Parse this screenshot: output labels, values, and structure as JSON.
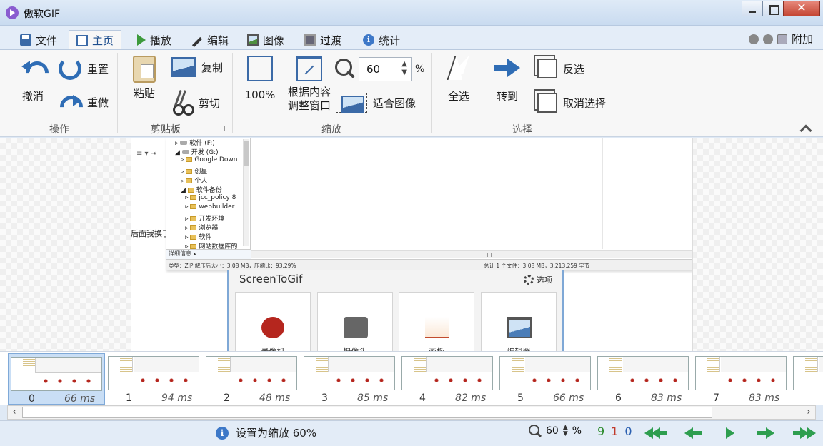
{
  "window": {
    "title": "傲软GIF"
  },
  "tabs": {
    "file": "文件",
    "home": "主页",
    "play": "播放",
    "edit": "编辑",
    "image": "图像",
    "transition": "过渡",
    "stats": "统计",
    "extras": "附加"
  },
  "ribbon": {
    "action": {
      "undo": "撤消",
      "reset": "重置",
      "redo": "重做",
      "label": "操作"
    },
    "clipboard": {
      "paste": "粘贴",
      "copy": "复制",
      "cut": "剪切",
      "label": "剪贴板"
    },
    "zoom": {
      "zoom100": "100%",
      "fit_window_line1": "根据内容",
      "fit_window_line2": "调整窗口",
      "zoom_value": "60",
      "percent": "%",
      "fit_image": "适合图像",
      "label": "缩放"
    },
    "select": {
      "select_all": "全选",
      "goto": "转到",
      "invert": "反选",
      "deselect": "取消选择",
      "label": "选择"
    }
  },
  "canvas": {
    "doc_text": "后面我换了",
    "tree": [
      "软件 (F:)",
      "开发 (G:)",
      "Google Down",
      "创星",
      "个人",
      "软件备份",
      "jcc_policy 8",
      "webbuilder",
      "开发环境",
      "浏览器",
      "软件",
      "网站数据库的"
    ],
    "details_pane": "详细信息",
    "explorer_status_left": "类型：ZIP  解压后大小：3.08 MB，压缩比：93.29%",
    "explorer_status_right": "总计 1 个文件：3.08 MB，3,213,259 字节",
    "app_title": "ScreenToGif",
    "options": "选项",
    "cards": [
      "录像机",
      "摄像头",
      "画板",
      "编辑器"
    ]
  },
  "frames": [
    {
      "index": "0",
      "ms": "66 ms"
    },
    {
      "index": "1",
      "ms": "94 ms"
    },
    {
      "index": "2",
      "ms": "48 ms"
    },
    {
      "index": "3",
      "ms": "85 ms"
    },
    {
      "index": "4",
      "ms": "82 ms"
    },
    {
      "index": "5",
      "ms": "66 ms"
    },
    {
      "index": "6",
      "ms": "83 ms"
    },
    {
      "index": "7",
      "ms": "83 ms"
    }
  ],
  "status": {
    "message": "设置为缩放 60%",
    "zoom": "60",
    "percent": "%",
    "total": "9",
    "selected": "1",
    "current": "0",
    "colors": {
      "total": "#2a8a2a",
      "selected": "#c0392b",
      "current": "#2a5fb0"
    }
  }
}
